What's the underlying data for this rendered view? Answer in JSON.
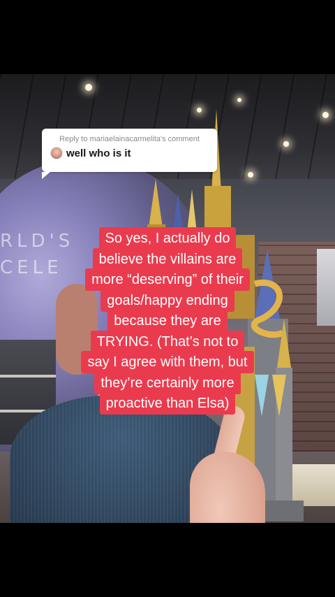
{
  "comment_reply": {
    "header": "Reply to mariaelainacarmelita's comment",
    "text": "well who is it"
  },
  "caption": {
    "lines": [
      "So yes, I actually do",
      "believe the villains are",
      "more “deserving” of their",
      "goals/happy ending",
      "because they are",
      "TRYING. (That’s not to",
      "say I agree with them, but",
      "they’re certainly more",
      "proactive than Elsa)"
    ],
    "highlight_color": "#ea3b4e"
  },
  "background_sign": {
    "text": "RLD'S\nCELE"
  }
}
